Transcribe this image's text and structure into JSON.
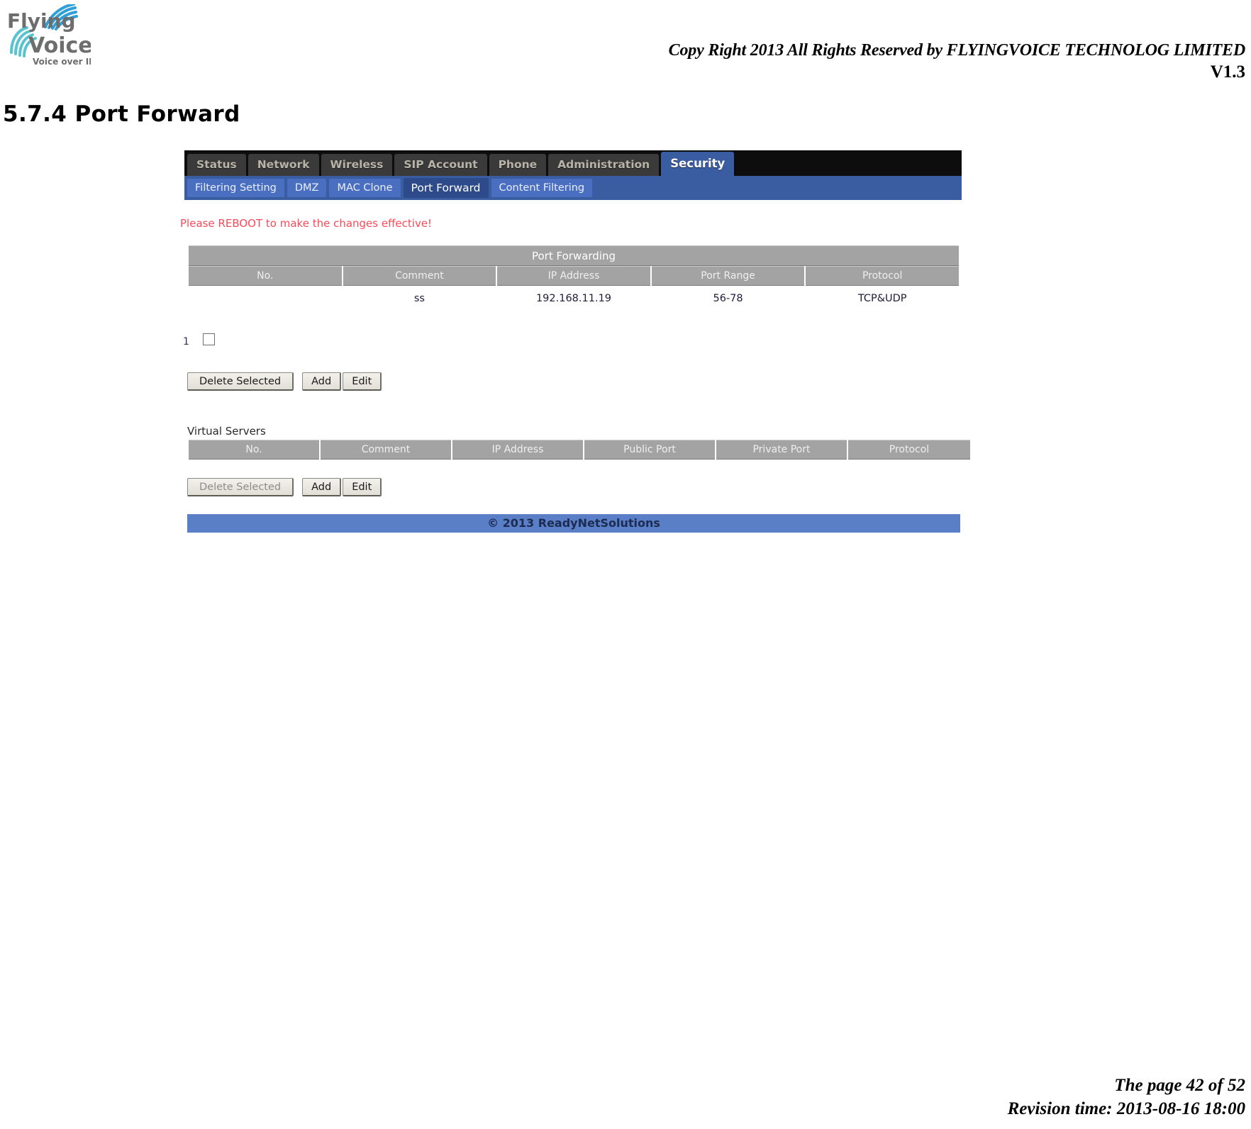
{
  "document": {
    "header_copyright": "Copy Right 2013 All Rights Reserved by FLYINGVOICE TECHNOLOG LIMITED",
    "header_version": "V1.3",
    "section_title": "5.7.4 Port Forward",
    "logo_alt": "Flying Voice — Voice over IP",
    "footer_page": "The page 42 of 52",
    "footer_revision": "Revision time: 2013-08-16 18:00"
  },
  "router_ui": {
    "main_nav": [
      {
        "label": "Status",
        "active": false
      },
      {
        "label": "Network",
        "active": false
      },
      {
        "label": "Wireless",
        "active": false
      },
      {
        "label": "SIP Account",
        "active": false
      },
      {
        "label": "Phone",
        "active": false
      },
      {
        "label": "Administration",
        "active": false
      },
      {
        "label": "Security",
        "active": true
      }
    ],
    "sub_nav": [
      {
        "label": "Filtering Setting",
        "active": false
      },
      {
        "label": "DMZ",
        "active": false
      },
      {
        "label": "MAC Clone",
        "active": false
      },
      {
        "label": "Port Forward",
        "active": true
      },
      {
        "label": "Content Filtering",
        "active": false
      }
    ],
    "warning": "Please REBOOT to make the changes effective!",
    "port_forwarding": {
      "title": "Port Forwarding",
      "columns": [
        "No.",
        "Comment",
        "IP Address",
        "Port Range",
        "Protocol"
      ],
      "rows": [
        {
          "no": "1",
          "checked": false,
          "comment": "ss",
          "ip_address": "192.168.11.19",
          "port_range": "56-78",
          "protocol": "TCP&UDP"
        }
      ],
      "buttons": {
        "delete": "Delete Selected",
        "add": "Add",
        "edit": "Edit"
      }
    },
    "virtual_servers": {
      "label": "Virtual Servers",
      "columns": [
        "No.",
        "Comment",
        "IP Address",
        "Public Port",
        "Private Port",
        "Protocol"
      ],
      "rows": [],
      "buttons": {
        "delete": "Delete Selected",
        "add": "Add",
        "edit": "Edit"
      }
    },
    "footer": "© 2013 ReadyNetSolutions"
  },
  "colors": {
    "nav_bg": "#0d0d0d",
    "nav_tab": "#3a3a3a",
    "accent_blue": "#3a5ca0",
    "subnav_tab": "#4a6fc0",
    "table_header": "#a3a3a3",
    "warning_red": "#fa4a5a",
    "footer_blue": "#5b7fc7"
  }
}
